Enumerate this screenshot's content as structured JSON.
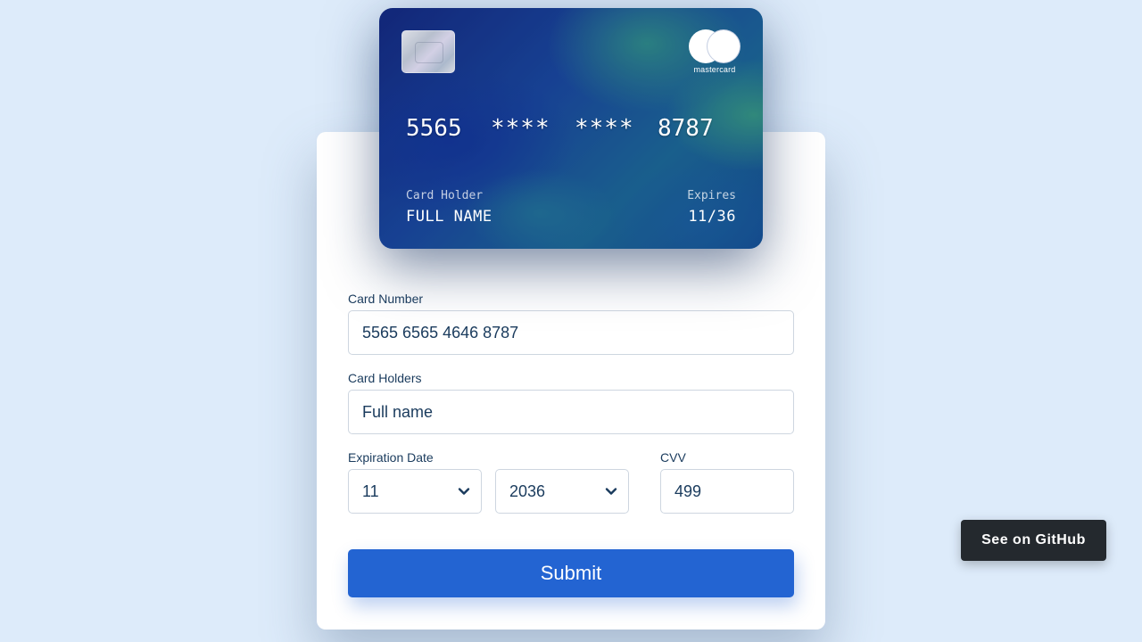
{
  "card": {
    "brand": "mastercard",
    "number_group_1": "5565",
    "number_group_2": "****",
    "number_group_3": "****",
    "number_group_4": "8787",
    "holder_label": "Card Holder",
    "holder_value": "FULL NAME",
    "expires_label": "Expires",
    "expires_value": "11/36"
  },
  "form": {
    "card_number_label": "Card Number",
    "card_number_value": "5565 6565 4646 8787",
    "card_holders_label": "Card Holders",
    "card_holders_value": "Full name",
    "expiration_label": "Expiration Date",
    "month_value": "11",
    "year_value": "2036",
    "cvv_label": "CVV",
    "cvv_value": "499",
    "submit_label": "Submit"
  },
  "github": {
    "label": "See on GitHub"
  },
  "colors": {
    "background": "#ddebfa",
    "accent": "#2364d2",
    "text": "#1a3b5d",
    "github_button": "#24292e"
  }
}
